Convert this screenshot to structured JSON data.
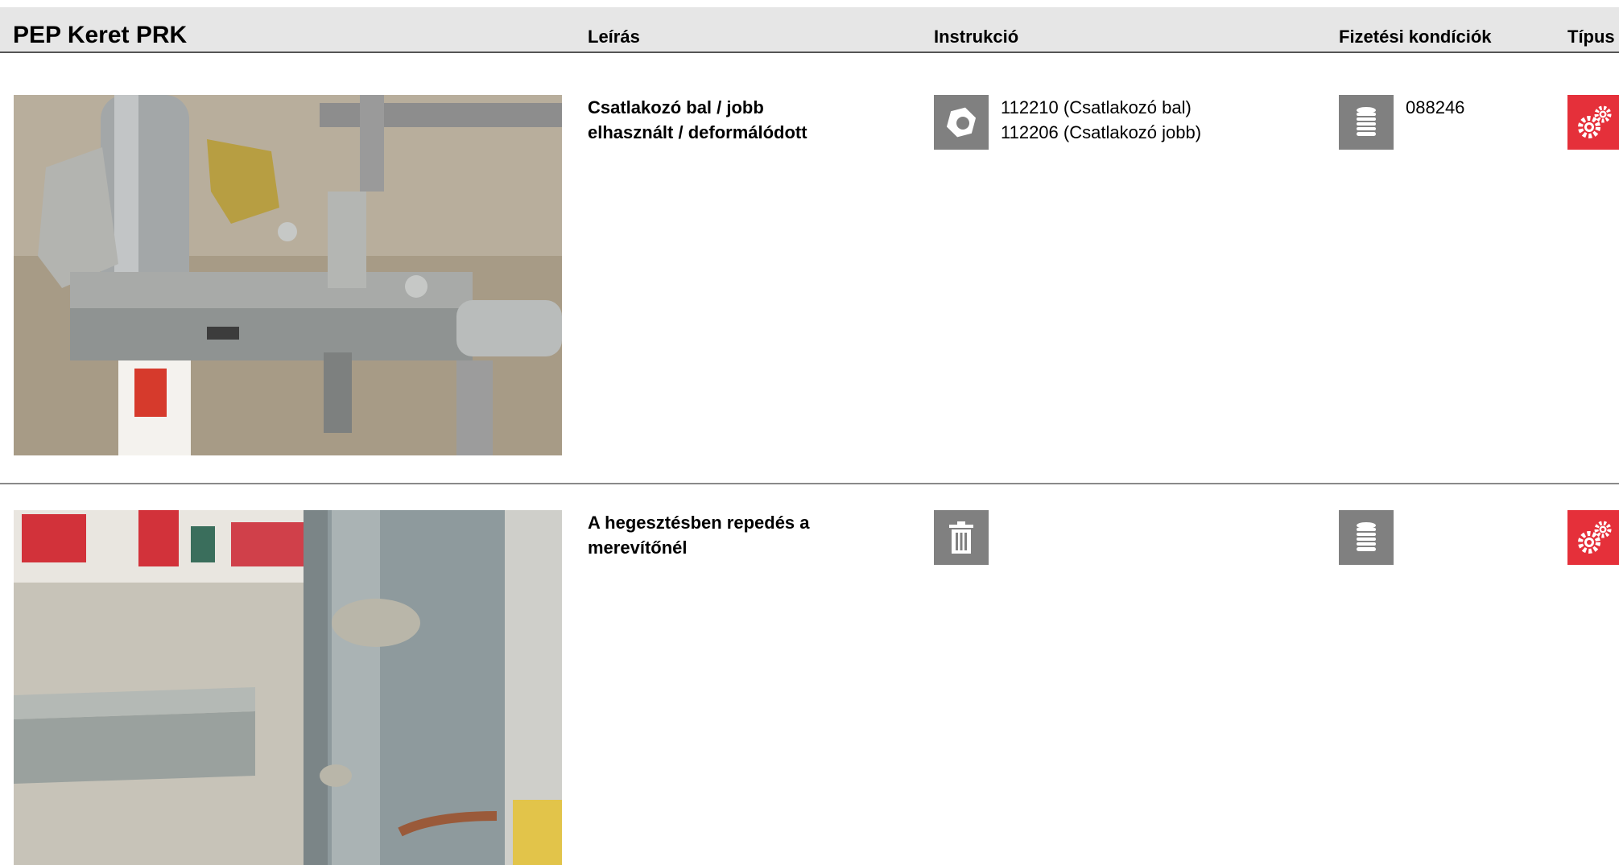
{
  "header": {
    "title": "PEP Keret PRK",
    "col_description": "Leírás",
    "col_instruction": "Instrukció",
    "col_payment": "Fizetési kondíciók",
    "col_type": "Típus"
  },
  "rows": [
    {
      "description_line1": "Csatlakozó bal / jobb",
      "description_line2": "elhasznált / deformálódott",
      "instruction_icon": "nut-icon",
      "instruction_codes": [
        "112210 (Csatlakozó bal)",
        "112206 (Csatlakozó jobb)"
      ],
      "payment_icon": "coin-stack-icon",
      "payment_code": "088246",
      "type_icon": "gears-icon"
    },
    {
      "description_line1": "A hegesztésben repedés a",
      "description_line2": "merevítőnél",
      "instruction_icon": "trash-icon",
      "instruction_codes": [],
      "payment_icon": "coin-stack-icon",
      "payment_code": "",
      "type_icon": "gears-icon"
    }
  ],
  "colors": {
    "icon_gray": "#808080",
    "type_red": "#e5303a",
    "header_bg": "#e6e6e6"
  }
}
